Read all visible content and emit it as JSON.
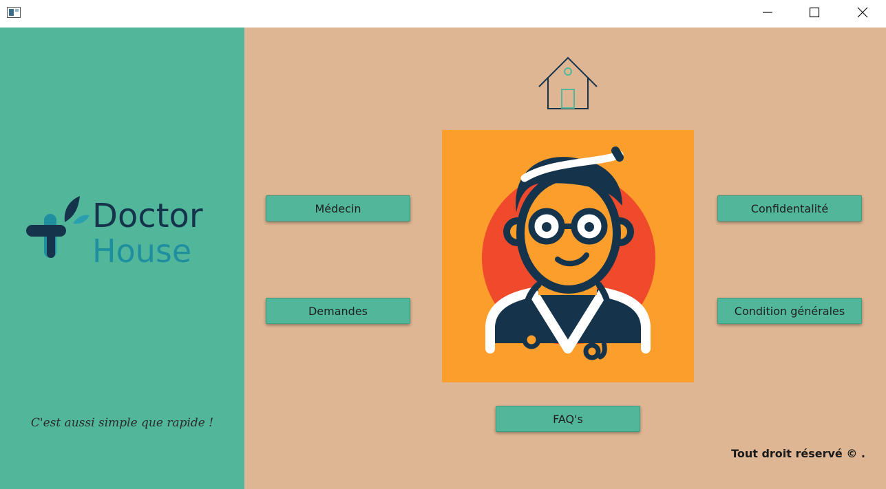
{
  "window": {
    "minimize_icon": "minimize-icon",
    "maximize_icon": "maximize-icon",
    "close_icon": "close-icon"
  },
  "sidebar": {
    "logo": {
      "line1": "Doctor",
      "line2": "House"
    },
    "tagline": "C'est aussi simple que rapide !"
  },
  "main": {
    "buttons": {
      "medecin": "Médecin",
      "demandes": "Demandes",
      "confidentialite": "Confidentalité",
      "conditions": "Condition générales",
      "faq": "FAQ's"
    },
    "footer": "Tout droit réservé  © ."
  },
  "colors": {
    "sidebar": "#52b79a",
    "main_bg": "#deb693",
    "doctor_bg": "#fb9e2b",
    "doctor_circle": "#ef4a2c",
    "navy": "#15344c"
  }
}
